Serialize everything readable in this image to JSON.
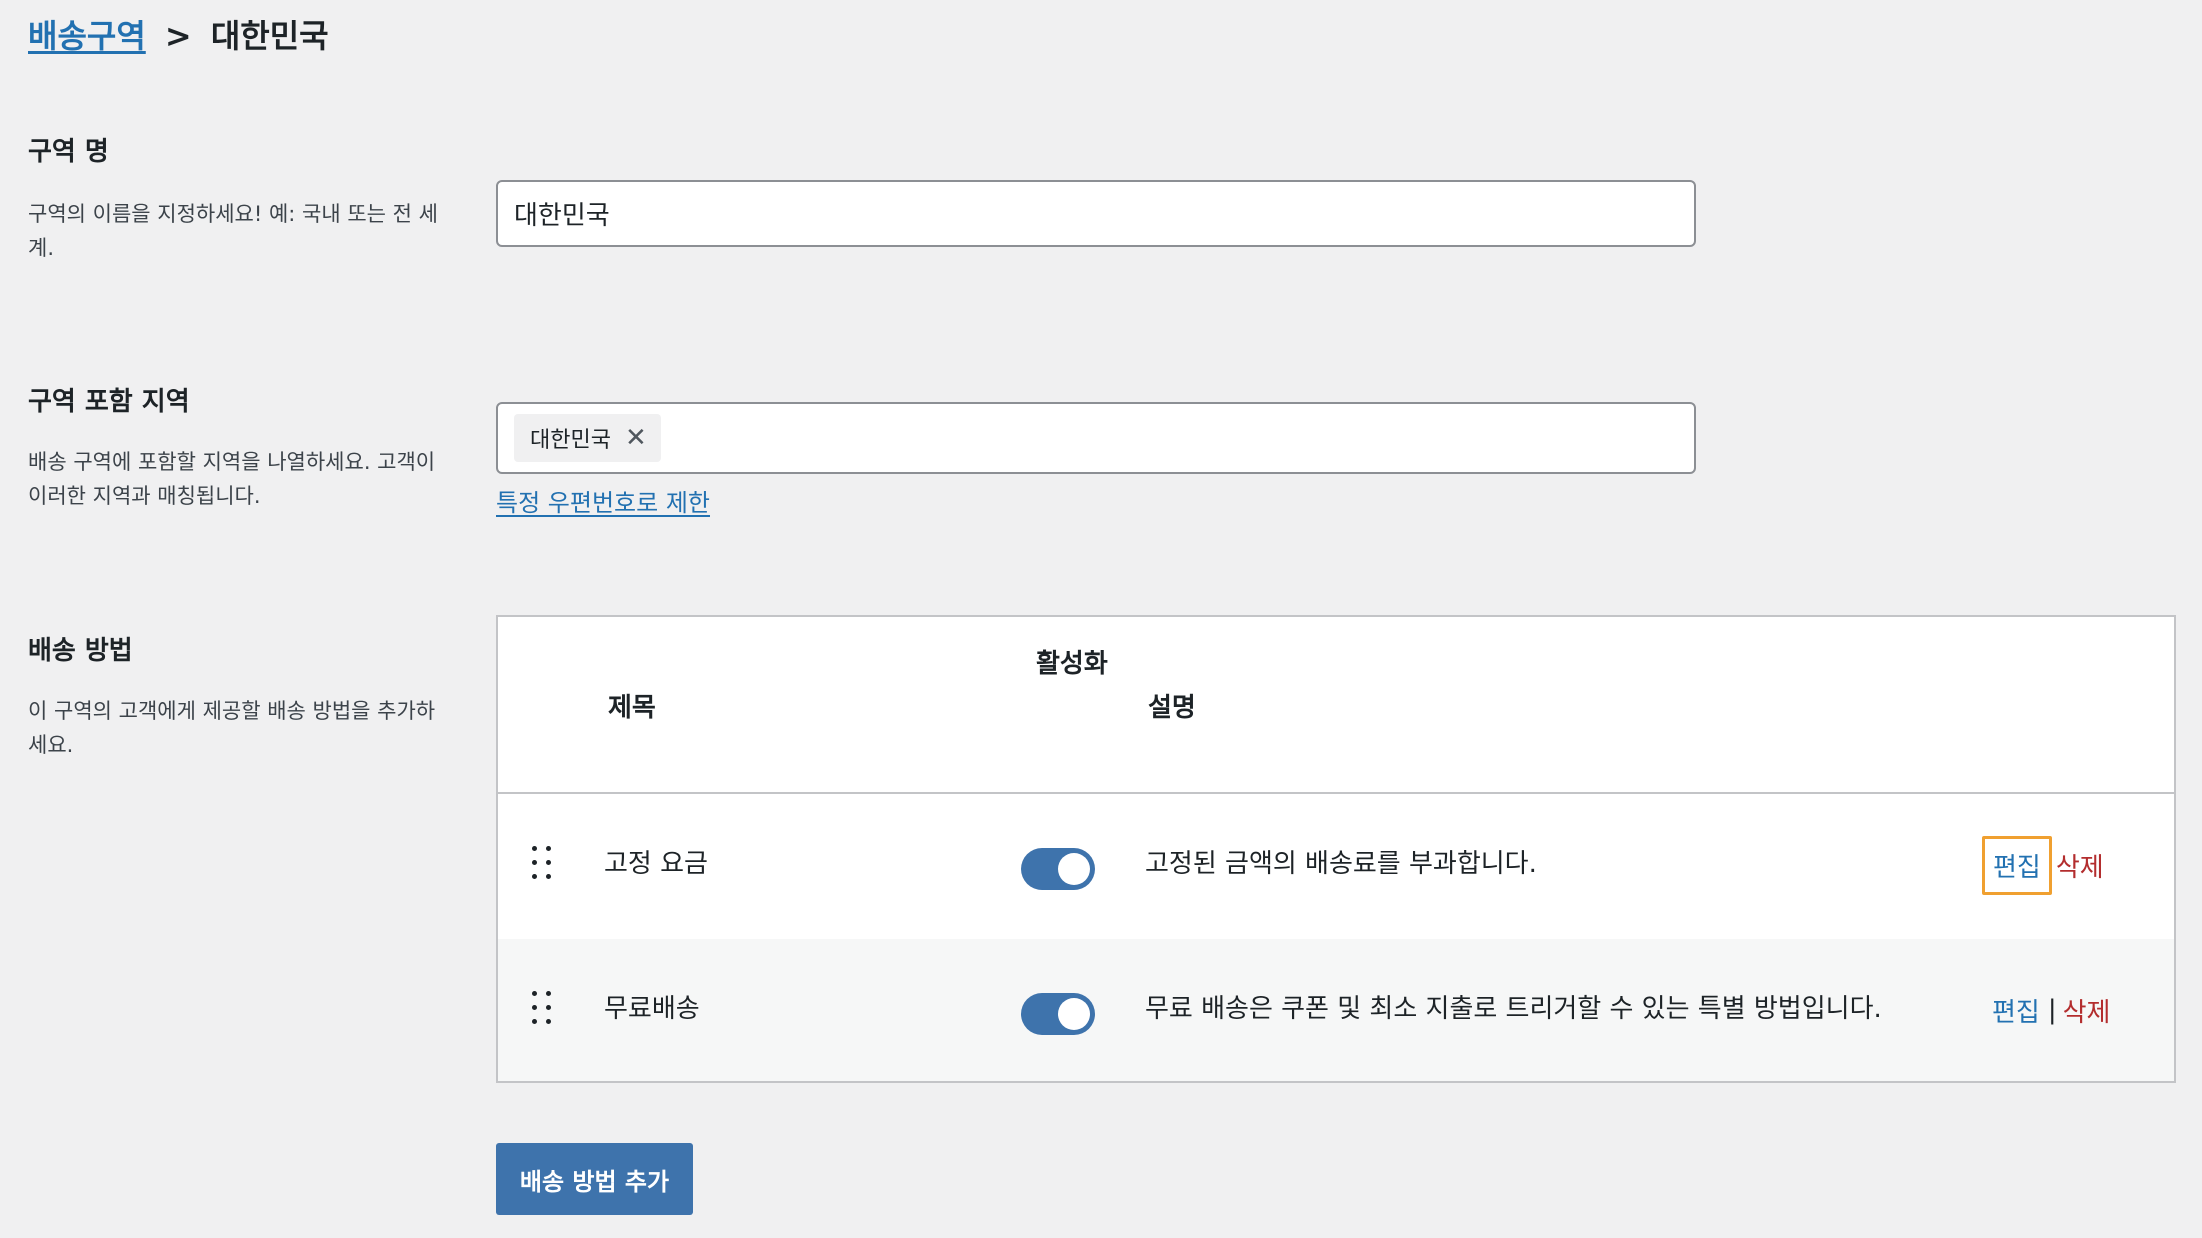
{
  "breadcrumb": {
    "parent": "배송구역",
    "separator": ">",
    "current": "대한민국"
  },
  "zone_name": {
    "title": "구역 명",
    "description": "구역의 이름을 지정하세요! 예: 국내 또는 전 세계.",
    "value": "대한민국"
  },
  "zone_regions": {
    "title": "구역 포함 지역",
    "description": "배송 구역에 포함할 지역을 나열하세요. 고객이 이러한 지역과 매칭됩니다.",
    "chips": [
      "대한민국"
    ],
    "remove_icon": "close-icon",
    "limit_link": "특정 우편번호로 제한"
  },
  "shipping_methods": {
    "title": "배송 방법",
    "description": "이 구역의 고객에게 제공할 배송 방법을 추가하세요.",
    "columns": {
      "title": "제목",
      "enabled": "활성화",
      "description": "설명"
    },
    "rows": [
      {
        "title": "고정 요금",
        "enabled": true,
        "description": "고정된 금액의 배송료를 부과합니다.",
        "edit": "편집",
        "delete": "삭제"
      },
      {
        "title": "무료배송",
        "enabled": true,
        "description": "무료 배송은 쿠폰 및 최소 지출로 트리거할 수 있는 특별 방법입니다.",
        "edit": "편집",
        "separator": "|",
        "delete": "삭제"
      }
    ],
    "add_button": "배송 방법 추가"
  },
  "colors": {
    "accent": "#3e73ac",
    "link": "#2271b1",
    "delete": "#b32d2e",
    "focus": "#f0a030"
  }
}
